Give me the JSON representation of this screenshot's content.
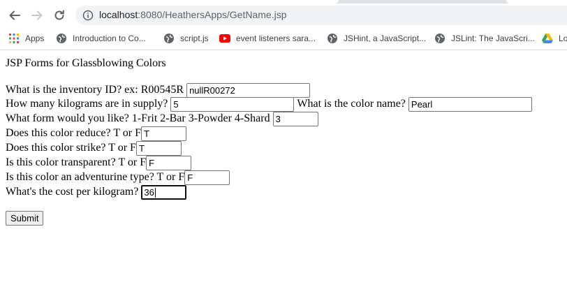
{
  "browser": {
    "url_host": "localhost",
    "url_path": ":8080/HeathersApps/GetName.jsp",
    "bookmarks": [
      {
        "label": "Apps",
        "icon": "apps-grid-icon"
      },
      {
        "label": "Introduction to Co...",
        "icon": "globe-icon"
      },
      {
        "label": "script.js",
        "icon": "globe-icon"
      },
      {
        "label": "event listeners sara...",
        "icon": "youtube-icon"
      },
      {
        "label": "JSHint, a JavaScript...",
        "icon": "globe-icon"
      },
      {
        "label": "JSLint: The JavaScri...",
        "icon": "globe-icon"
      },
      {
        "label": "Lo",
        "icon": "google-drive-icon"
      }
    ]
  },
  "page": {
    "heading": "JSP Forms for Glassblowing Colors",
    "fields": {
      "inventory_label": "What is the inventory ID? ex: R00545R",
      "inventory_value": "nullR00272",
      "kilograms_label": "How many kilograms are in supply?",
      "kilograms_value": "5",
      "color_name_label": "What is the color name?",
      "color_name_value": "Pearl",
      "form_label": "What form would you like? 1-Frit 2-Bar 3-Powder 4-Shard",
      "form_value": "3",
      "reduce_label": "Does this color reduce? T or F",
      "reduce_value": "T",
      "strike_label": "Does this color strike? T or F",
      "strike_value": "T",
      "transparent_label": "Is this color transparent? T or F",
      "transparent_value": "F",
      "adventurine_label": "Is this color an adventurine type? T or F",
      "adventurine_value": "F",
      "cost_label": "What's the cost per kilogram?",
      "cost_value": "36"
    },
    "submit_label": "Submit"
  }
}
